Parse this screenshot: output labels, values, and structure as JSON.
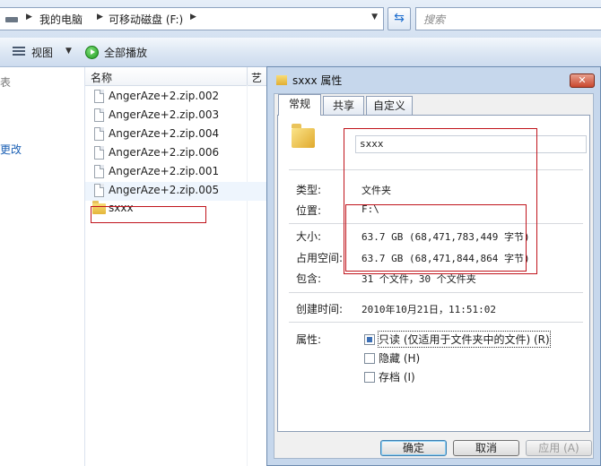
{
  "address_bar": {
    "crumbs": [
      "我的电脑",
      "可移动磁盘 (F:)"
    ],
    "search_placeholder": "搜索"
  },
  "toolbar": {
    "views_label": "视图",
    "play_all_label": "全部播放"
  },
  "nav_pane": {
    "fragment_top": "表",
    "fragment_change": "更改"
  },
  "file_list": {
    "header_name": "名称",
    "header_next": "艺",
    "files": [
      "AngerAze+2.zip.002",
      "AngerAze+2.zip.003",
      "AngerAze+2.zip.004",
      "AngerAze+2.zip.006",
      "AngerAze+2.zip.001",
      "AngerAze+2.zip.005"
    ],
    "folder": "sxxx"
  },
  "dialog": {
    "title": "sxxx 属性",
    "close_glyph": "✕",
    "tabs": [
      "常规",
      "共享",
      "自定义"
    ],
    "folder_name_value": "sxxx",
    "props": [
      {
        "label": "类型:",
        "value": "文件夹"
      },
      {
        "label": "位置:",
        "value": "F:\\"
      },
      {
        "label": "大小:",
        "value": "63.7 GB (68,471,783,449 字节)"
      },
      {
        "label": "占用空间:",
        "value": "63.7 GB (68,471,844,864 字节)"
      },
      {
        "label": "包含:",
        "value": "31 个文件，30 个文件夹"
      },
      {
        "label": "创建时间:",
        "value": "2010年10月21日，11:51:02"
      }
    ],
    "attributes_label": "属性:",
    "attributes": [
      "只读 (仅适用于文件夹中的文件) (R)",
      "隐藏 (H)",
      "存档 (I)"
    ],
    "buttons": {
      "ok": "确定",
      "cancel": "取消",
      "apply": "应用 (A)"
    }
  },
  "colors": {
    "annotation_red": "#c0141c",
    "link_blue": "#1a5fb4",
    "dialog_frame": "#c6d7ec"
  }
}
